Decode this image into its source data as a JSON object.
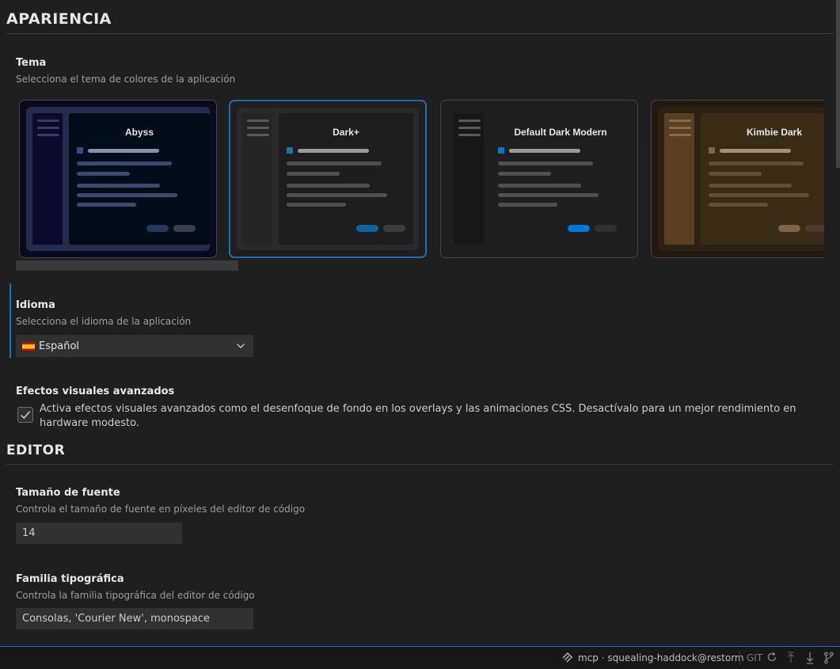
{
  "appearance": {
    "title": "APARIENCIA",
    "theme": {
      "title": "Tema",
      "desc": "Selecciona el tema de colores de la aplicación",
      "cards": [
        {
          "name": "Abyss",
          "selected": false
        },
        {
          "name": "Dark+",
          "selected": true
        },
        {
          "name": "Default Dark Modern",
          "selected": false
        },
        {
          "name": "Kimbie Dark",
          "selected": false
        }
      ]
    },
    "language": {
      "title": "Idioma",
      "desc": "Selecciona el idioma de la aplicación",
      "value": "Español"
    },
    "effects": {
      "title": "Efectos visuales avanzados",
      "desc": "Activa efectos visuales avanzados como el desenfoque de fondo en los overlays y las animaciones CSS. Desactívalo para un mejor rendimiento en hardware modesto.",
      "checked": true
    }
  },
  "editor": {
    "title": "EDITOR",
    "font_size": {
      "title": "Tamaño de fuente",
      "desc": "Controla el tamaño de fuente en píxeles del editor de código",
      "value": "14"
    },
    "font_family": {
      "title": "Familia tipográfica",
      "desc": "Controla la familia tipográfica del editor de código",
      "value": "Consolas, 'Courier New', monospace"
    }
  },
  "statusbar": {
    "connection": "mcp · squealing-haddock@restorm",
    "git_label": "GIT"
  },
  "colors": {
    "accent": "#0078d4",
    "background": "#1f1f1f"
  }
}
